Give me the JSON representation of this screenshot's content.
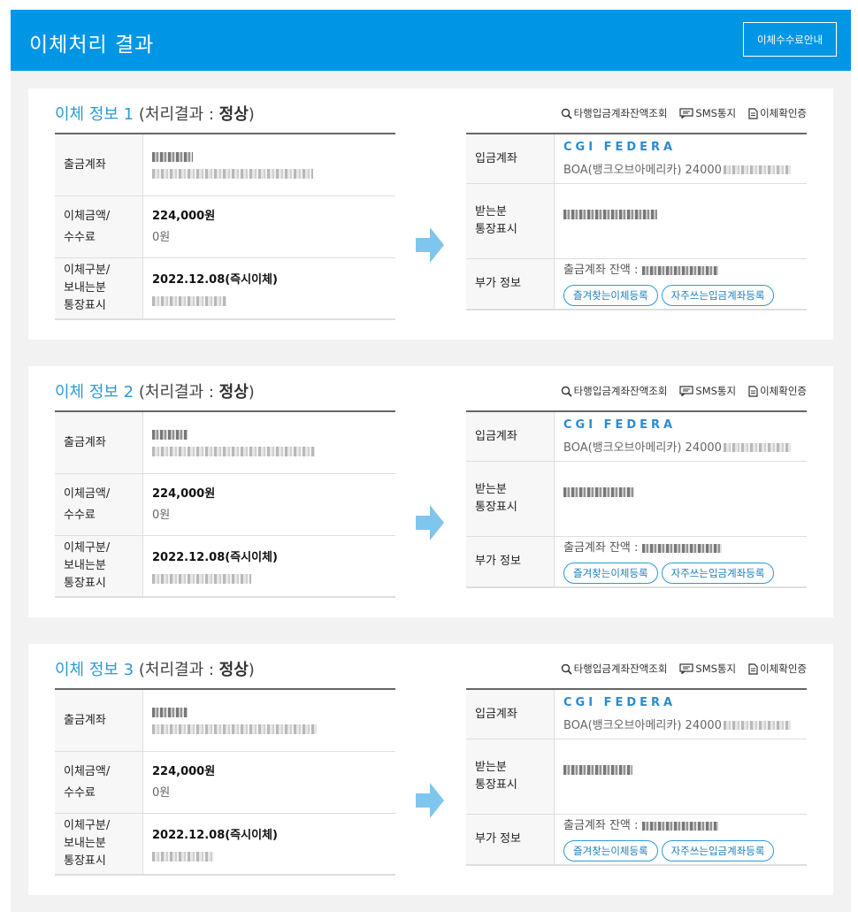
{
  "header": {
    "title": "이체처리 결과",
    "fee_button": "이체수수료안내"
  },
  "actions": {
    "balance_check": "타행입금계좌잔액조회",
    "sms": "SMS통지",
    "confirm": "이체확인증"
  },
  "labels": {
    "withdraw_account": "출금계좌",
    "amount_l1": "이체금액/",
    "amount_l2": "수수료",
    "type_l1": "이체구분/",
    "type_l2": "보내는분",
    "type_l3": "통장표시",
    "deposit_account": "입금계좌",
    "receiver_l1": "받는분",
    "receiver_l2": "통장표시",
    "extra_info": "부가 정보",
    "balance_prefix": "출금계좌 잔액 :",
    "fav_register": "즐겨찾는이체등록",
    "freq_register": "자주쓰는입금계좌등록"
  },
  "transfers": [
    {
      "title_prefix": "이체 정보 1",
      "result_label": " (처리결과 : ",
      "result": "정상",
      "result_suffix": ")",
      "amount": "224,000원",
      "fee": "0원",
      "date_type": "2022.12.08(즉시이체)",
      "bank_name": "CGI  FEDERA",
      "bank_acct": "BOA(뱅크오브아메리카) 24000"
    },
    {
      "title_prefix": "이체 정보 2",
      "result_label": " (처리결과 : ",
      "result": "정상",
      "result_suffix": ")",
      "amount": "224,000원",
      "fee": "0원",
      "date_type": "2022.12.08(즉시이체)",
      "bank_name": "CGI  FEDERA",
      "bank_acct": "BOA(뱅크오브아메리카) 24000"
    },
    {
      "title_prefix": "이체 정보 3",
      "result_label": " (처리결과 : ",
      "result": "정상",
      "result_suffix": ")",
      "amount": "224,000원",
      "fee": "0원",
      "date_type": "2022.12.08(즉시이체)",
      "bank_name": "CGI  FEDERA",
      "bank_acct": "BOA(뱅크오브아메리카) 24000"
    }
  ]
}
